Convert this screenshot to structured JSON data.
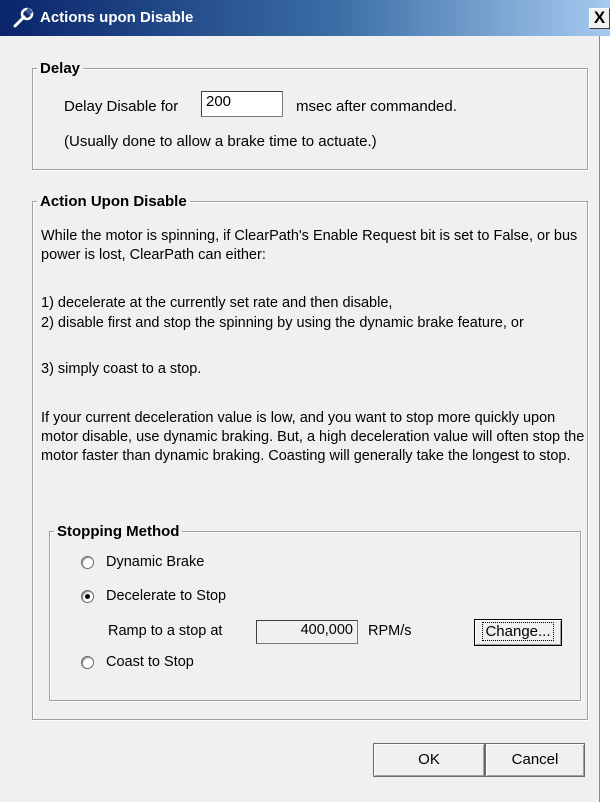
{
  "window": {
    "title": "Actions upon Disable",
    "close_glyph": "X",
    "title_icon": "wrench-icon"
  },
  "delay": {
    "legend": "Delay",
    "label_before": "Delay Disable for",
    "value": "200",
    "label_after": "msec after commanded.",
    "note": "(Usually done to allow a brake time to actuate.)"
  },
  "action": {
    "legend": "Action Upon Disable",
    "para1": "While the motor is spinning, if ClearPath's Enable Request bit is set to False, or bus power is lost, ClearPath can either:",
    "options_text": [
      "1) decelerate at the currently set rate and then disable,",
      "2) disable first and stop the spinning by using the dynamic brake feature, or",
      "3) simply coast to a stop."
    ],
    "para2": "If your current deceleration value is low, and you want to stop more quickly upon motor disable, use dynamic braking. But, a high deceleration value will often stop the motor faster than dynamic braking. Coasting will generally take the longest to stop."
  },
  "stopping": {
    "legend": "Stopping Method",
    "dynamic_brake": "Dynamic Brake",
    "decelerate": "Decelerate to Stop",
    "ramp_label": "Ramp to a stop at",
    "ramp_value": "400,000",
    "ramp_unit": "RPM/s",
    "change": "Change...",
    "coast": "Coast to Stop",
    "selected": "Decelerate to Stop"
  },
  "buttons": {
    "ok": "OK",
    "cancel": "Cancel"
  }
}
